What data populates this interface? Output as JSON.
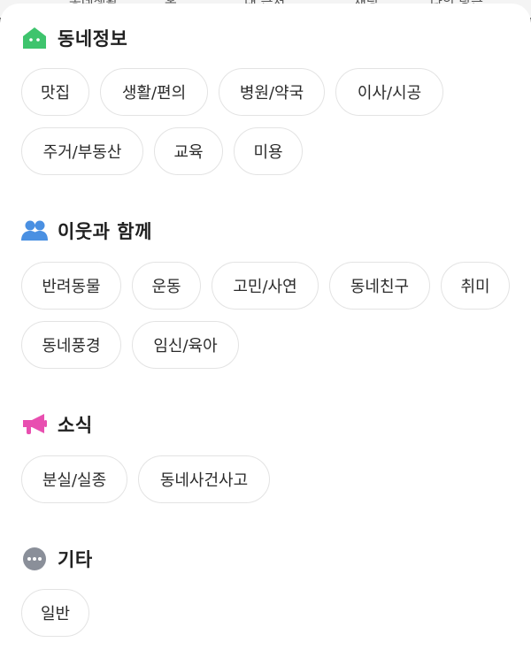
{
  "background_tabs": [
    "동네생활",
    "홈",
    "내 근처",
    "채팅",
    "나의 당근"
  ],
  "sections": [
    {
      "title": "동네정보",
      "icon": "house-icon",
      "icon_color": "#3ec46d",
      "chips": [
        "맛집",
        "생활/편의",
        "병원/약국",
        "이사/시공",
        "주거/부동산",
        "교육",
        "미용"
      ]
    },
    {
      "title": "이웃과 함께",
      "icon": "people-icon",
      "icon_color": "#4a90e2",
      "chips": [
        "반려동물",
        "운동",
        "고민/사연",
        "동네친구",
        "취미",
        "동네풍경",
        "임신/육아"
      ]
    },
    {
      "title": "소식",
      "icon": "megaphone-icon",
      "icon_color": "#e84fb0",
      "chips": [
        "분실/실종",
        "동네사건사고"
      ]
    },
    {
      "title": "기타",
      "icon": "more-icon",
      "icon_color": "#8a8f99",
      "chips": [
        "일반"
      ]
    }
  ]
}
